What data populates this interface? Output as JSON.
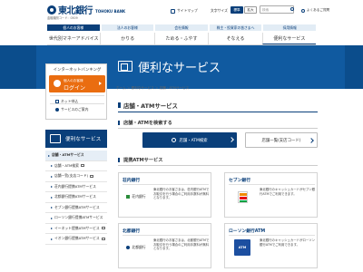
{
  "header": {
    "logo_name": "東北銀行",
    "logo_en": "TOHOKU BANK",
    "bank_code": "金融機関コード：0509",
    "sitemap_label": "サイトマップ",
    "fontsize_label": "文字サイズ",
    "size_standard": "標準",
    "size_large": "拡大",
    "search_placeholder": "検索",
    "qa_label": "よくあるご質問"
  },
  "audience_tabs": [
    "個人のお客様",
    "法人のお客様",
    "会社情報",
    "株主・投資家の皆さまへ",
    "採用情報"
  ],
  "main_nav": [
    "世代別マネーアドバイス",
    "かりる",
    "ためる・ふやす",
    "そなえる",
    "便利なサービス"
  ],
  "banner": {
    "title": "便利なサービス"
  },
  "internet_banking": {
    "title": "インターネットバンキング",
    "login_sub": "個人のお客様",
    "login_label": "ログイン",
    "links": [
      "ネット申込",
      "サービスのご案内"
    ]
  },
  "sidebar": {
    "heading": "便利なサービス",
    "items": [
      {
        "label": "店舗・ATMサービス",
        "active": true,
        "child": false
      },
      {
        "label": "店舗・ATM検索",
        "active": false,
        "child": true
      },
      {
        "label": "店舗一覧(支店コード)",
        "active": false,
        "child": true
      },
      {
        "label": "荘内銀行提携ATMサービス",
        "active": false,
        "child": true
      },
      {
        "label": "北都銀行提携ATMサービス",
        "active": false,
        "child": true
      },
      {
        "label": "セブン銀行提携ATMサービス",
        "active": false,
        "child": true
      },
      {
        "label": "ローソン銀行提携ATMサービス",
        "active": false,
        "child": true
      },
      {
        "label": "イーネット提携ATMサービス",
        "active": false,
        "child": true
      },
      {
        "label": "イオン銀行提携ATMサービス",
        "active": false,
        "child": true
      }
    ]
  },
  "breadcrumb": "ホーム ＞ 便利なサービス ＞ 店舗・ATMサービス",
  "page_title": "店舗・ATMサービス",
  "search_section": {
    "heading": "店舗・ATMを検索する",
    "search_button": "店舗・ATM検索",
    "list_button": "店舗一覧(支店コード)"
  },
  "atm_section": {
    "heading": "提携ATMサービス",
    "cards": [
      {
        "title": "荘内銀行",
        "logo_text": "荘内銀行",
        "desc": "東北銀行のお客さまは、荘内銀行ATMでお取引を行う場合のご利用手数料が無料となります。"
      },
      {
        "title": "セブン銀行",
        "logo_text": "",
        "desc": "東北銀行のキャッシュカードがセブン銀行ATMでご利用できます。"
      },
      {
        "title": "北都銀行",
        "logo_text": "北都銀行",
        "desc": "東北銀行のお客さまは、北都銀行ATMでお取引を行う場合のご利用手数料が無料となります。"
      },
      {
        "title": "ローソン銀行ATM",
        "logo_text": "ATM",
        "desc": "東北銀行のキャッシュカードがローソン銀行ATMでご利用できます。"
      }
    ]
  },
  "colors": {
    "brand": "#0a3f7a",
    "banner": "#0b4d8c",
    "login": "#ea6d10"
  }
}
